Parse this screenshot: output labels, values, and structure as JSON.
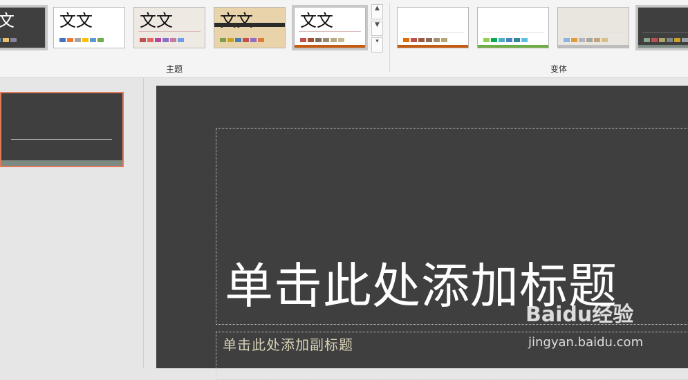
{
  "ribbon": {
    "themes_label": "主题",
    "variants_label": "变体",
    "themes": [
      {
        "glyph": "文",
        "bg": "#3f3f3f",
        "fg": "#ffffff",
        "swatches": [
          "#b1a26a",
          "#7b8a86",
          "#5b7f95",
          "#e8c16d",
          "#8b7fa0"
        ]
      },
      {
        "glyph": "文文",
        "bg": "#ffffff",
        "fg": "#111111",
        "swatches": [
          "#4472c4",
          "#ed7d31",
          "#a5a5a5",
          "#ffc000",
          "#5b9bd5",
          "#70ad47"
        ]
      },
      {
        "glyph": "文文",
        "bg": "#efe9e4",
        "fg": "#111111",
        "swatches": [
          "#c0504d",
          "#e06666",
          "#b04aa3",
          "#8e6dc9",
          "#c27ba0",
          "#6d9eeb"
        ]
      },
      {
        "glyph": "文文",
        "bg": "#e8d3aa",
        "fg": "#111111",
        "swatches": [
          "#7fa04a",
          "#c9a227",
          "#4a7fb0",
          "#c0504d",
          "#8e6dc9",
          "#e07b39"
        ]
      },
      {
        "glyph": "文文",
        "bg": "#ffffff",
        "fg": "#111111",
        "swatches": [
          "#c0504d",
          "#a0522d",
          "#7f6a5a",
          "#9b8c6a",
          "#b7a98a",
          "#c5b98e"
        ]
      }
    ],
    "variants": [
      {
        "bg": "#ffffff",
        "swatches": [
          "#e36c09",
          "#c0504d",
          "#9b5a3a",
          "#8b6a5a",
          "#a88f6a",
          "#b7a67a"
        ],
        "bar": "#c55a11"
      },
      {
        "bg": "#ffffff",
        "swatches": [
          "#92d050",
          "#00b050",
          "#4bacc6",
          "#4f81bd",
          "#31859c",
          "#5bc0de"
        ],
        "bar": "#70ad47"
      },
      {
        "bg": "#e8e6df",
        "swatches": [
          "#8db3e2",
          "#e29b3d",
          "#b7b7b7",
          "#a5a5a5",
          "#c9a27a",
          "#d3c28a"
        ],
        "bar": "#bdbdbd"
      },
      {
        "bg": "#3f3f3f",
        "swatches": [
          "#8aa38b",
          "#c0504d",
          "#b1a26a",
          "#7b8a86",
          "#c9a227",
          "#9aa0a6"
        ],
        "bar": "#7d8a82"
      }
    ]
  },
  "slide": {
    "title_placeholder": "单击此处添加标题",
    "subtitle_placeholder": "单击此处添加副标题"
  },
  "watermark": {
    "brand": "Baidu经验",
    "url": "jingyan.baidu.com"
  }
}
